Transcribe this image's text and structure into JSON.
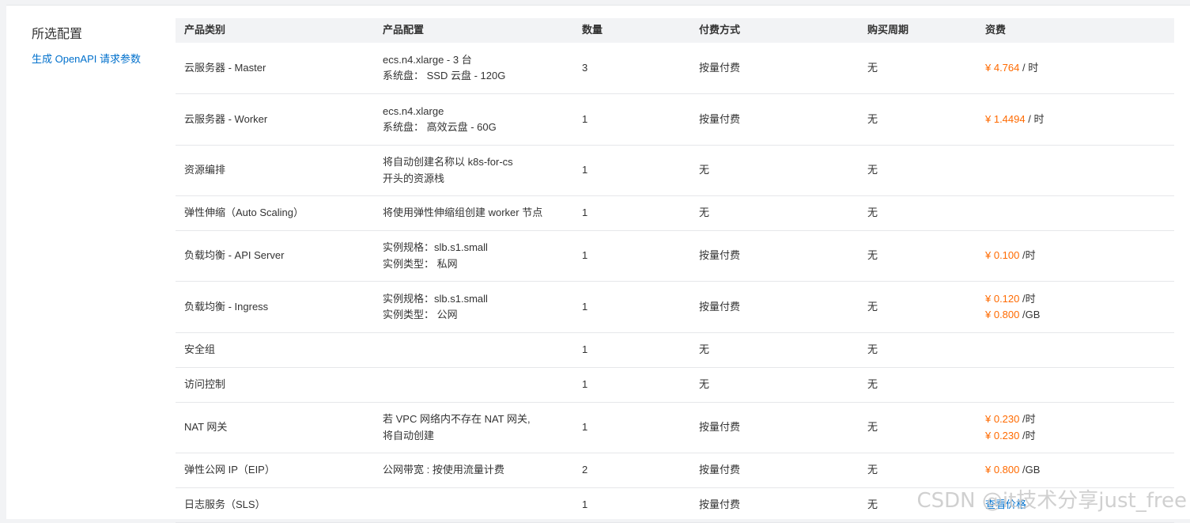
{
  "side": {
    "title": "所选配置",
    "openapi_link": "生成 OpenAPI 请求参数"
  },
  "table": {
    "headers": [
      "产品类别",
      "产品配置",
      "数量",
      "付费方式",
      "购买周期",
      "资费"
    ],
    "rows": [
      {
        "category": "云服务器 - Master",
        "config": [
          "ecs.n4.xlarge - 3 台",
          "系统盘：  SSD 云盘 - 120G"
        ],
        "qty": "3",
        "payment": "按量付费",
        "period": "无",
        "fees": [
          {
            "price": "¥ 4.764",
            "unit": " / 时"
          }
        ]
      },
      {
        "category": "云服务器 - Worker",
        "config": [
          "ecs.n4.xlarge",
          "系统盘：  高效云盘 - 60G"
        ],
        "qty": "1",
        "payment": "按量付费",
        "period": "无",
        "fees": [
          {
            "price": "¥ 1.4494",
            "unit": " / 时"
          }
        ]
      },
      {
        "category": "资源编排",
        "config": [
          "将自动创建名称以 k8s-for-cs",
          "开头的资源栈"
        ],
        "qty": "1",
        "payment": "无",
        "period": "无",
        "fees": []
      },
      {
        "category": "弹性伸缩（Auto Scaling）",
        "config": [
          "将使用弹性伸缩组创建 worker 节点"
        ],
        "qty": "1",
        "payment": "无",
        "period": "无",
        "fees": []
      },
      {
        "category": "负载均衡 - API Server",
        "config": [
          "实例规格：slb.s1.small",
          "实例类型：  私网"
        ],
        "qty": "1",
        "payment": "按量付费",
        "period": "无",
        "fees": [
          {
            "price": "¥  0.100",
            "unit": " /时"
          }
        ]
      },
      {
        "category": "负载均衡 - Ingress",
        "config": [
          "实例规格：slb.s1.small",
          "实例类型：  公网"
        ],
        "qty": "1",
        "payment": "按量付费",
        "period": "无",
        "fees": [
          {
            "price": "¥  0.120",
            "unit": " /时"
          },
          {
            "price": "¥  0.800",
            "unit": " /GB"
          }
        ]
      },
      {
        "category": "安全组",
        "config": [],
        "qty": "1",
        "payment": "无",
        "period": "无",
        "fees": []
      },
      {
        "category": "访问控制",
        "config": [],
        "qty": "1",
        "payment": "无",
        "period": "无",
        "fees": []
      },
      {
        "category": "NAT 网关",
        "config": [
          "若 VPC 网络内不存在 NAT 网关,",
          "将自动创建"
        ],
        "qty": "1",
        "payment": "按量付费",
        "period": "无",
        "fees": [
          {
            "price": "¥  0.230",
            "unit": " /时"
          },
          {
            "price": "¥  0.230",
            "unit": " /时"
          }
        ]
      },
      {
        "category": "弹性公网 IP（EIP）",
        "config": [
          "公网带宽 : 按使用流量计费"
        ],
        "qty": "2",
        "payment": "按量付费",
        "period": "无",
        "fees": [
          {
            "price": "¥  0.800",
            "unit": " /GB"
          }
        ]
      },
      {
        "category": "日志服务（SLS）",
        "config": [],
        "qty": "1",
        "payment": "按量付费",
        "period": "无",
        "fees": [],
        "fee_link": "查看价格"
      }
    ]
  },
  "watermark": "CSDN @it技术分享just_free",
  "colors": {
    "price": "#ff6a00",
    "link": "#0070cc",
    "header_bg": "#f2f3f5"
  }
}
